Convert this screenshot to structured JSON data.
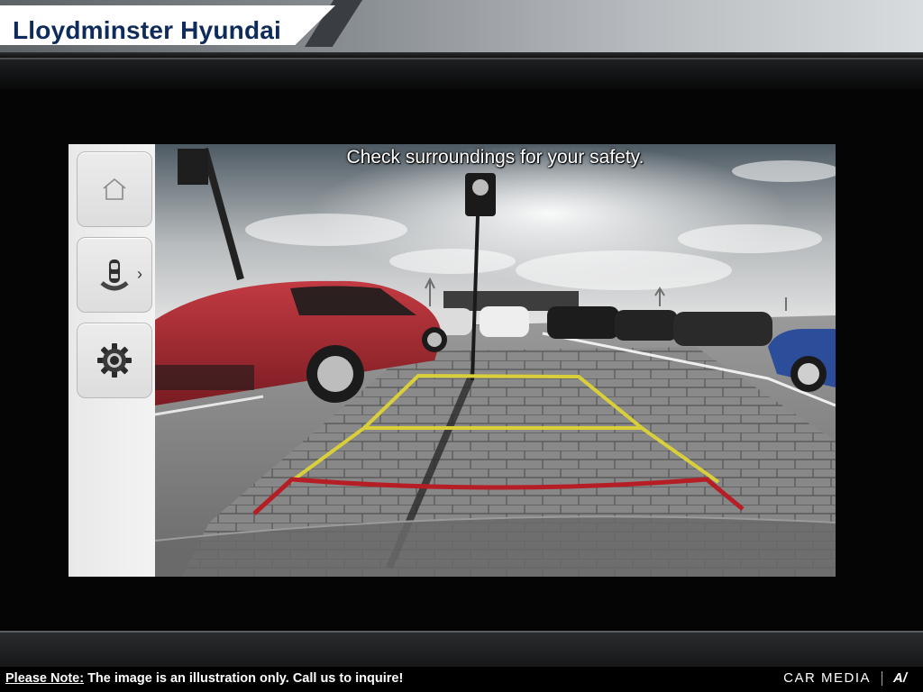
{
  "dealer": {
    "name": "Lloydminster Hyundai"
  },
  "camera": {
    "safety_message": "Check surroundings for your safety.",
    "guideline_colors": {
      "far": "#d8cf3a",
      "near": "#b51e24"
    }
  },
  "side_panel": {
    "buttons": [
      {
        "icon": "home-icon"
      },
      {
        "icon": "parking-sensor-icon",
        "chevron": "›"
      },
      {
        "icon": "settings-icon"
      }
    ]
  },
  "footer": {
    "note_label": "Please Note:",
    "note_text": " The image is an illustration only. Call us to inquire!",
    "brand": "CAR MEDIA",
    "brand_logo": "A/"
  }
}
